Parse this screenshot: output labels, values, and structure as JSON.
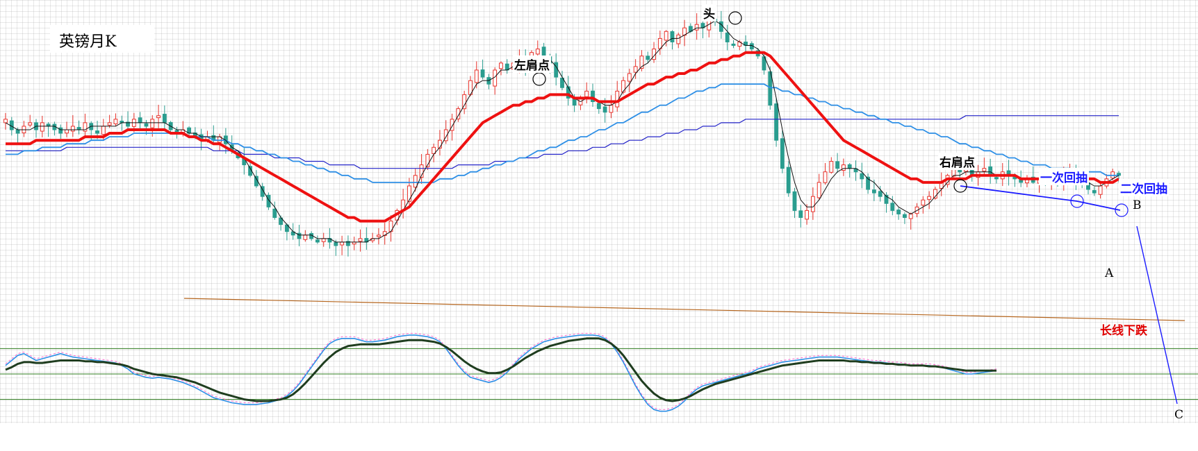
{
  "chart_data": {
    "type": "candlestick",
    "title": "英镑月K",
    "annotations": {
      "head": "头",
      "left_shoulder": "左肩点",
      "right_shoulder": "右肩点",
      "first_pullback": "一次回抽",
      "second_pullback": "二次回抽",
      "long_term_down": "长线下跌",
      "point_a": "A",
      "point_b": "B",
      "point_c": "C"
    },
    "price_ylim": [
      5,
      88
    ],
    "close": [
      58,
      55,
      54,
      56,
      57,
      55,
      57,
      56,
      55,
      54,
      55,
      56,
      55,
      57,
      55,
      54,
      56,
      57,
      58,
      57,
      56,
      58,
      57,
      56,
      58,
      59,
      57,
      55,
      54,
      55,
      54,
      53,
      52,
      53,
      52,
      53,
      51,
      49,
      47,
      45,
      42,
      39,
      36,
      33,
      30,
      28,
      26,
      25,
      24,
      25,
      24,
      23,
      24,
      23,
      22,
      23,
      22,
      23,
      24,
      23,
      24,
      25,
      26,
      29,
      32,
      35,
      39,
      42,
      45,
      48,
      50,
      52,
      55,
      58,
      61,
      65,
      69,
      72,
      70,
      68,
      72,
      74,
      72,
      74,
      75,
      73,
      77,
      78,
      76,
      74,
      70,
      67,
      64,
      62,
      64,
      66,
      63,
      61,
      60,
      62,
      66,
      69,
      71,
      73,
      76,
      75,
      78,
      81,
      83,
      80,
      82,
      84,
      83,
      85,
      84,
      87,
      86,
      83,
      80,
      79,
      80,
      79,
      78,
      76,
      72,
      62,
      52,
      44,
      37,
      32,
      30,
      32,
      36,
      40,
      43,
      46,
      44,
      45,
      44,
      43,
      41,
      38,
      37,
      36,
      34,
      32,
      31,
      30,
      31,
      33,
      35,
      36,
      38,
      40,
      42,
      44,
      43,
      44,
      42,
      43,
      44,
      42,
      41,
      43,
      42,
      41,
      40,
      41,
      40,
      41,
      40,
      41,
      40,
      42,
      43,
      41,
      40,
      38,
      37,
      39,
      41,
      43,
      42
    ],
    "ma_thin_black": [
      57,
      56,
      55,
      55,
      55,
      56,
      56,
      56,
      56,
      55,
      55,
      55,
      55,
      55,
      56,
      56,
      56,
      56,
      56,
      57,
      57,
      57,
      57,
      57,
      57,
      57,
      57,
      56,
      55,
      55,
      54,
      54,
      53,
      53,
      53,
      53,
      52,
      50,
      49,
      47,
      44,
      41,
      38,
      35,
      33,
      30,
      28,
      26,
      25,
      25,
      25,
      24,
      24,
      24,
      23,
      23,
      23,
      23,
      23,
      23,
      24,
      24,
      25,
      26,
      29,
      32,
      35,
      38,
      42,
      45,
      48,
      50,
      53,
      56,
      59,
      62,
      65,
      68,
      69,
      69,
      70,
      72,
      72,
      73,
      74,
      74,
      75,
      76,
      76,
      75,
      73,
      70,
      67,
      64,
      63,
      64,
      64,
      63,
      62,
      62,
      63,
      66,
      68,
      71,
      73,
      74,
      76,
      78,
      80,
      81,
      81,
      82,
      83,
      84,
      84,
      85,
      86,
      85,
      83,
      81,
      80,
      79,
      79,
      78,
      76,
      72,
      64,
      55,
      47,
      40,
      35,
      33,
      33,
      35,
      38,
      41,
      43,
      44,
      44,
      44,
      43,
      41,
      40,
      38,
      36,
      35,
      33,
      32,
      31,
      32,
      33,
      34,
      36,
      38,
      40,
      42,
      42,
      43,
      43,
      43,
      43,
      43,
      42,
      42,
      42,
      42,
      41,
      41,
      41,
      41,
      40,
      40,
      40,
      41,
      41,
      41,
      41,
      40,
      39,
      39,
      40,
      41,
      42
    ],
    "ma_red": [
      51,
      51,
      51,
      51,
      51,
      52,
      52,
      52,
      52,
      52,
      52,
      52,
      52,
      53,
      53,
      53,
      53,
      54,
      54,
      54,
      55,
      55,
      55,
      55,
      55,
      55,
      55,
      54,
      54,
      54,
      53,
      53,
      52,
      52,
      51,
      51,
      50,
      49,
      48,
      47,
      46,
      45,
      44,
      43,
      42,
      41,
      40,
      39,
      38,
      37,
      36,
      35,
      34,
      33,
      32,
      31,
      30,
      30,
      29,
      29,
      29,
      29,
      29,
      30,
      31,
      32,
      33,
      35,
      37,
      39,
      41,
      43,
      45,
      47,
      49,
      51,
      53,
      55,
      57,
      58,
      59,
      60,
      61,
      62,
      62,
      63,
      63,
      64,
      64,
      65,
      65,
      65,
      65,
      64,
      64,
      64,
      64,
      63,
      63,
      63,
      63,
      64,
      65,
      66,
      67,
      68,
      68,
      69,
      70,
      70,
      71,
      71,
      72,
      72,
      73,
      74,
      74,
      75,
      75,
      76,
      76,
      77,
      77,
      77,
      77,
      76,
      74,
      72,
      70,
      68,
      66,
      64,
      62,
      60,
      58,
      56,
      54,
      52,
      51,
      50,
      49,
      48,
      47,
      46,
      45,
      44,
      43,
      42,
      41,
      41,
      40,
      40,
      40,
      40,
      41,
      41,
      41,
      41,
      42,
      42,
      42,
      42,
      42,
      42,
      42,
      42,
      41,
      41,
      41,
      41,
      41,
      41,
      41,
      41,
      41,
      41,
      41,
      41,
      41,
      40,
      40,
      40,
      41
    ],
    "ma_light_blue": [
      48,
      48,
      48,
      49,
      49,
      49,
      50,
      50,
      50,
      50,
      51,
      51,
      51,
      51,
      52,
      52,
      52,
      53,
      53,
      53,
      53,
      54,
      54,
      54,
      54,
      54,
      54,
      54,
      54,
      54,
      53,
      53,
      53,
      53,
      52,
      52,
      52,
      51,
      51,
      50,
      50,
      49,
      49,
      48,
      48,
      47,
      47,
      46,
      46,
      45,
      45,
      44,
      44,
      43,
      43,
      42,
      42,
      41,
      41,
      41,
      40,
      40,
      40,
      40,
      40,
      40,
      40,
      40,
      40,
      40,
      40,
      41,
      41,
      41,
      42,
      42,
      43,
      43,
      44,
      44,
      45,
      45,
      46,
      46,
      47,
      47,
      48,
      49,
      49,
      50,
      50,
      51,
      52,
      52,
      53,
      53,
      54,
      55,
      55,
      56,
      57,
      57,
      58,
      59,
      60,
      60,
      61,
      62,
      62,
      63,
      64,
      64,
      65,
      66,
      66,
      67,
      67,
      68,
      68,
      68,
      68,
      68,
      68,
      68,
      68,
      67,
      67,
      66,
      66,
      65,
      65,
      64,
      64,
      63,
      63,
      62,
      62,
      61,
      61,
      60,
      60,
      59,
      59,
      58,
      58,
      57,
      57,
      56,
      56,
      55,
      55,
      54,
      54,
      53,
      53,
      52,
      51,
      51,
      50,
      50,
      49,
      49,
      48,
      48,
      47,
      47,
      46,
      46,
      45,
      45,
      45,
      44,
      44,
      44,
      44,
      43,
      43,
      43,
      43,
      43,
      42,
      42,
      42
    ],
    "ma_dark_blue": [
      49,
      49,
      49,
      49,
      49,
      49,
      49,
      49,
      49,
      49,
      50,
      50,
      50,
      50,
      50,
      50,
      50,
      50,
      50,
      50,
      50,
      50,
      50,
      50,
      50,
      50,
      50,
      50,
      50,
      50,
      50,
      50,
      50,
      50,
      49,
      49,
      49,
      49,
      49,
      48,
      48,
      48,
      48,
      48,
      47,
      47,
      47,
      47,
      47,
      46,
      46,
      46,
      46,
      45,
      45,
      45,
      45,
      45,
      44,
      44,
      44,
      44,
      44,
      44,
      44,
      44,
      44,
      44,
      44,
      44,
      44,
      44,
      44,
      44,
      45,
      45,
      45,
      45,
      45,
      45,
      46,
      46,
      46,
      46,
      47,
      47,
      47,
      47,
      48,
      48,
      48,
      48,
      49,
      49,
      49,
      49,
      50,
      50,
      50,
      51,
      51,
      51,
      52,
      52,
      52,
      53,
      53,
      53,
      54,
      54,
      54,
      55,
      55,
      55,
      56,
      56,
      56,
      57,
      57,
      57,
      57,
      58,
      58,
      58,
      58,
      58,
      58,
      58,
      58,
      58,
      58,
      58,
      58,
      58,
      58,
      58,
      58,
      58,
      58,
      58,
      58,
      58,
      58,
      58,
      58,
      58,
      58,
      58,
      58,
      58,
      58,
      58,
      58,
      58,
      58,
      58,
      58,
      59,
      59,
      59,
      59,
      59,
      59,
      59,
      59,
      59,
      59,
      59,
      59,
      59,
      59,
      59,
      59,
      59,
      59,
      59,
      59,
      59,
      59,
      59,
      59,
      59,
      59
    ],
    "osc_ylim": [
      0,
      100
    ],
    "osc_levels": [
      80,
      50,
      20
    ],
    "osc_blue": [
      60,
      66,
      72,
      74,
      70,
      66,
      68,
      70,
      72,
      74,
      72,
      70,
      69,
      68,
      67,
      66,
      65,
      64,
      63,
      60,
      56,
      50,
      48,
      46,
      45,
      46,
      45,
      44,
      42,
      40,
      37,
      34,
      30,
      26,
      22,
      20,
      18,
      16,
      15,
      14,
      14,
      14,
      15,
      16,
      18,
      20,
      24,
      30,
      38,
      48,
      58,
      68,
      78,
      86,
      90,
      92,
      92,
      92,
      90,
      88,
      88,
      89,
      90,
      92,
      94,
      95,
      96,
      96,
      95,
      94,
      92,
      88,
      80,
      70,
      60,
      52,
      46,
      44,
      42,
      40,
      42,
      46,
      52,
      60,
      68,
      74,
      80,
      84,
      88,
      90,
      92,
      93,
      94,
      95,
      96,
      96,
      96,
      95,
      92,
      86,
      76,
      64,
      50,
      36,
      24,
      14,
      8,
      6,
      6,
      8,
      12,
      18,
      26,
      32,
      36,
      38,
      40,
      42,
      44,
      46,
      48,
      50,
      52,
      56,
      58,
      60,
      62,
      64,
      65,
      66,
      67,
      68,
      69,
      70,
      70,
      70,
      70,
      69,
      68,
      67,
      66,
      65,
      64,
      64,
      63,
      62,
      62,
      61,
      60,
      60,
      60,
      60,
      59,
      58,
      56,
      54,
      52,
      50,
      50,
      51,
      52,
      53,
      54
    ],
    "osc_black": [
      55,
      58,
      62,
      64,
      64,
      63,
      63,
      64,
      65,
      66,
      66,
      66,
      66,
      65,
      65,
      64,
      64,
      63,
      62,
      61,
      59,
      56,
      54,
      52,
      50,
      49,
      48,
      47,
      46,
      44,
      42,
      40,
      37,
      34,
      31,
      28,
      26,
      24,
      22,
      20,
      19,
      18,
      18,
      18,
      19,
      20,
      22,
      26,
      32,
      39,
      47,
      55,
      63,
      70,
      76,
      80,
      83,
      84,
      85,
      85,
      85,
      85,
      86,
      87,
      88,
      89,
      90,
      90,
      90,
      89,
      88,
      86,
      82,
      77,
      71,
      65,
      60,
      56,
      53,
      51,
      51,
      52,
      55,
      59,
      64,
      69,
      73,
      77,
      80,
      83,
      85,
      87,
      89,
      90,
      91,
      92,
      92,
      92,
      90,
      86,
      80,
      72,
      62,
      52,
      42,
      34,
      27,
      22,
      19,
      18,
      19,
      21,
      24,
      28,
      32,
      35,
      38,
      40,
      42,
      44,
      46,
      48,
      50,
      52,
      54,
      56,
      58,
      60,
      61,
      62,
      63,
      64,
      65,
      66,
      66,
      66,
      66,
      66,
      65,
      65,
      64,
      64,
      63,
      63,
      62,
      62,
      61,
      61,
      60,
      60,
      60,
      59,
      59,
      58,
      57,
      56,
      55,
      54,
      54,
      54,
      54,
      54,
      54
    ]
  }
}
